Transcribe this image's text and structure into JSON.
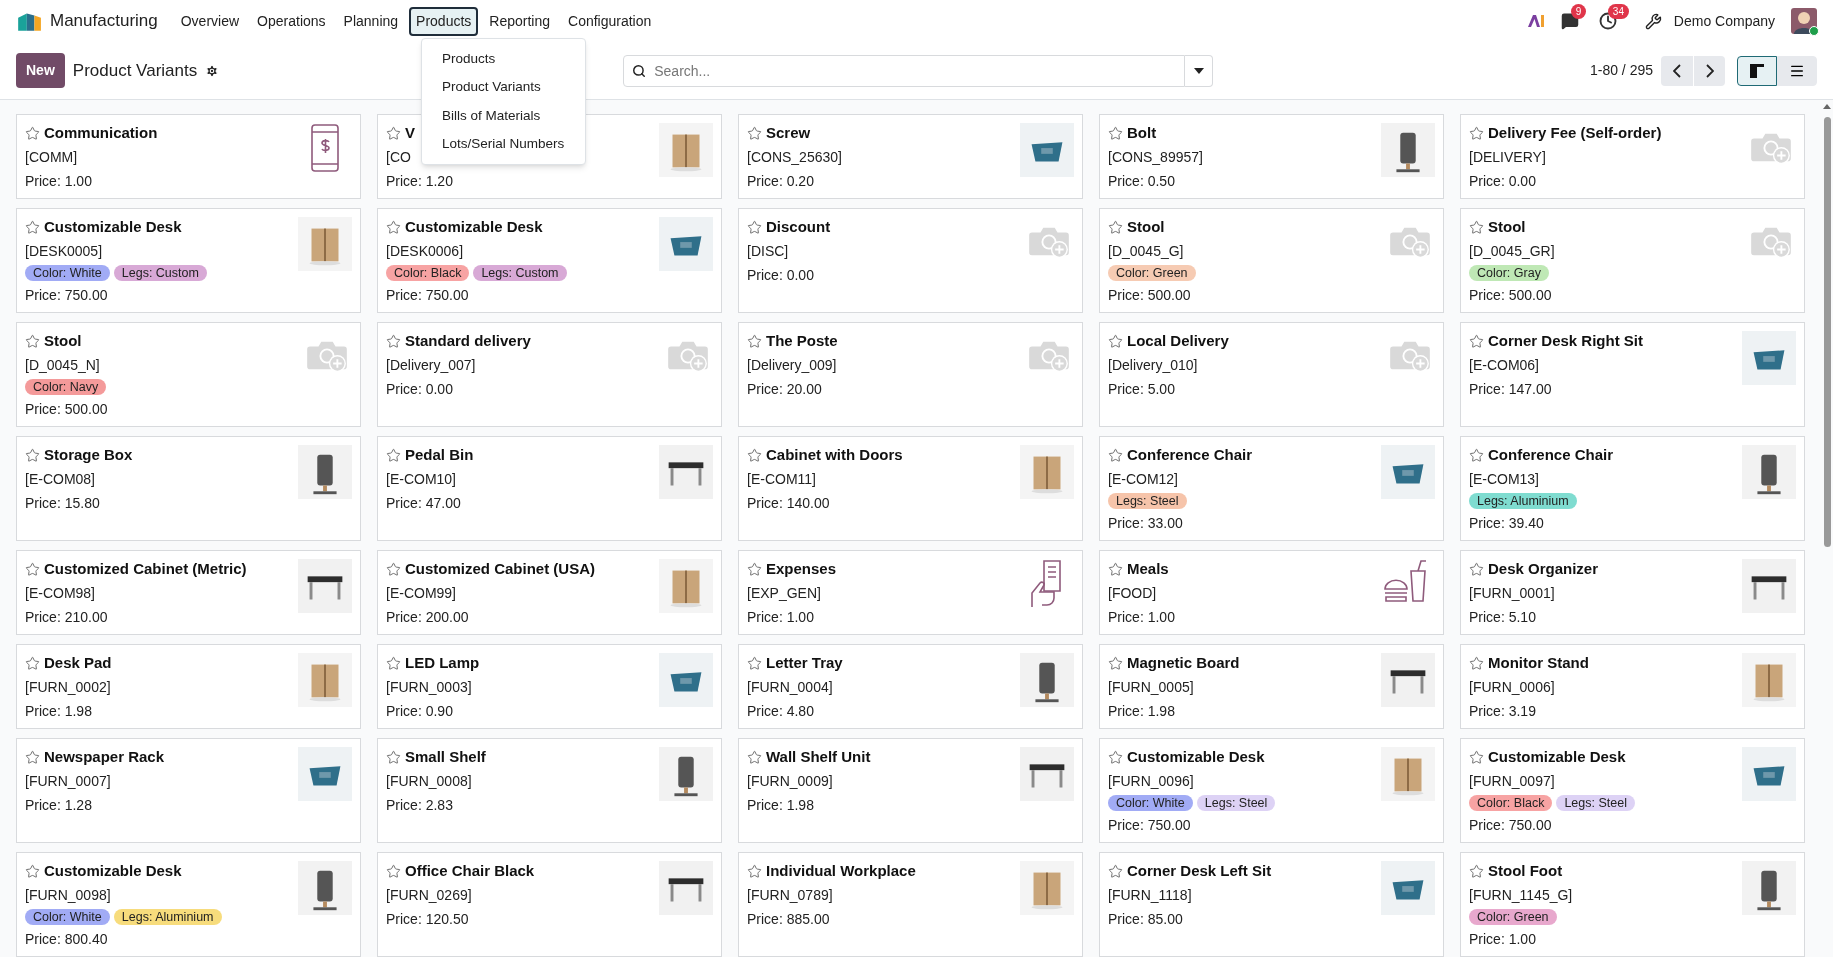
{
  "app": {
    "name": "Manufacturing"
  },
  "nav": [
    {
      "label": "Overview",
      "selected": false
    },
    {
      "label": "Operations",
      "selected": false
    },
    {
      "label": "Planning",
      "selected": false
    },
    {
      "label": "Products",
      "selected": true
    },
    {
      "label": "Reporting",
      "selected": false
    },
    {
      "label": "Configuration",
      "selected": false
    }
  ],
  "dropdown": {
    "items": [
      "Products",
      "Product Variants",
      "Bills of Materials",
      "Lots/Serial Numbers"
    ]
  },
  "systray": {
    "messages_badge": "9",
    "activities_badge": "34",
    "company": "Demo Company"
  },
  "control_panel": {
    "new_button": "New",
    "title": "Product Variants",
    "search": {
      "placeholder": "Search..."
    },
    "pager": "1-80 / 295",
    "views": [
      {
        "kind": "kanban",
        "selected": true
      },
      {
        "kind": "list",
        "selected": false
      }
    ]
  },
  "cards": [
    {
      "name": "Communication",
      "code": "[COMM]",
      "price": "Price: 1.00",
      "kind": "phone"
    },
    {
      "name": "V",
      "code": "[CO",
      "price": "Price: 1.20",
      "kind": "picture"
    },
    {
      "name": "Screw",
      "code": "[CONS_25630]",
      "price": "Price: 0.20",
      "kind": "picture"
    },
    {
      "name": "Bolt",
      "code": "[CONS_89957]",
      "price": "Price: 0.50",
      "kind": "picture"
    },
    {
      "name": "Delivery Fee (Self-order)",
      "code": "[DELIVERY]",
      "price": "Price: 0.00",
      "kind": "camera"
    },
    {
      "name": "Customizable Desk",
      "code": "[DESK0005]",
      "price": "Price: 750.00",
      "kind": "picture",
      "tags": [
        {
          "label": "Color: White",
          "color": "#a1abf5"
        },
        {
          "label": "Legs: Custom",
          "color": "#d8a9d6"
        }
      ]
    },
    {
      "name": "Customizable Desk",
      "code": "[DESK0006]",
      "price": "Price: 750.00",
      "kind": "picture",
      "tags": [
        {
          "label": "Color: Black",
          "color": "#f7a3a3"
        },
        {
          "label": "Legs: Custom",
          "color": "#d8a9d6"
        }
      ]
    },
    {
      "name": "Discount",
      "code": "[DISC]",
      "price": "Price: 0.00",
      "kind": "camera"
    },
    {
      "name": "Stool",
      "code": "[D_0045_G]",
      "price": "Price: 500.00",
      "kind": "camera",
      "tags": [
        {
          "label": "Color: Green",
          "color": "#f6cbb3"
        }
      ]
    },
    {
      "name": "Stool",
      "code": "[D_0045_GR]",
      "price": "Price: 500.00",
      "kind": "camera",
      "tags": [
        {
          "label": "Color: Gray",
          "color": "#bfe8b5"
        }
      ]
    },
    {
      "name": "Stool",
      "code": "[D_0045_N]",
      "price": "Price: 500.00",
      "kind": "camera",
      "tags": [
        {
          "label": "Color: Navy",
          "color": "#f49a9a"
        }
      ]
    },
    {
      "name": "Standard delivery",
      "code": "[Delivery_007]",
      "price": "Price: 0.00",
      "kind": "camera"
    },
    {
      "name": "The Poste",
      "code": "[Delivery_009]",
      "price": "Price: 20.00",
      "kind": "camera"
    },
    {
      "name": "Local Delivery",
      "code": "[Delivery_010]",
      "price": "Price: 5.00",
      "kind": "camera"
    },
    {
      "name": "Corner Desk Right Sit",
      "code": "[E-COM06]",
      "price": "Price: 147.00",
      "kind": "picture"
    },
    {
      "name": "Storage Box",
      "code": "[E-COM08]",
      "price": "Price: 15.80",
      "kind": "picture"
    },
    {
      "name": "Pedal Bin",
      "code": "[E-COM10]",
      "price": "Price: 47.00",
      "kind": "picture"
    },
    {
      "name": "Cabinet with Doors",
      "code": "[E-COM11]",
      "price": "Price: 140.00",
      "kind": "picture"
    },
    {
      "name": "Conference Chair",
      "code": "[E-COM12]",
      "price": "Price: 33.00",
      "kind": "picture",
      "tags": [
        {
          "label": "Legs: Steel",
          "color": "#f6c4aa"
        }
      ]
    },
    {
      "name": "Conference Chair",
      "code": "[E-COM13]",
      "price": "Price: 39.40",
      "kind": "picture",
      "tags": [
        {
          "label": "Legs: Aluminium",
          "color": "#7fdcd0"
        }
      ]
    },
    {
      "name": "Customized Cabinet (Metric)",
      "code": "[E-COM98]",
      "price": "Price: 210.00",
      "kind": "picture"
    },
    {
      "name": "Customized Cabinet (USA)",
      "code": "[E-COM99]",
      "price": "Price: 200.00",
      "kind": "picture"
    },
    {
      "name": "Expenses",
      "code": "[EXP_GEN]",
      "price": "Price: 1.00",
      "kind": "receipt"
    },
    {
      "name": "Meals",
      "code": "[FOOD]",
      "price": "Price: 1.00",
      "kind": "meal"
    },
    {
      "name": "Desk Organizer",
      "code": "[FURN_0001]",
      "price": "Price: 5.10",
      "kind": "picture"
    },
    {
      "name": "Desk Pad",
      "code": "[FURN_0002]",
      "price": "Price: 1.98",
      "kind": "picture"
    },
    {
      "name": "LED Lamp",
      "code": "[FURN_0003]",
      "price": "Price: 0.90",
      "kind": "picture"
    },
    {
      "name": "Letter Tray",
      "code": "[FURN_0004]",
      "price": "Price: 4.80",
      "kind": "picture"
    },
    {
      "name": "Magnetic Board",
      "code": "[FURN_0005]",
      "price": "Price: 1.98",
      "kind": "picture"
    },
    {
      "name": "Monitor Stand",
      "code": "[FURN_0006]",
      "price": "Price: 3.19",
      "kind": "picture"
    },
    {
      "name": "Newspaper Rack",
      "code": "[FURN_0007]",
      "price": "Price: 1.28",
      "kind": "picture"
    },
    {
      "name": "Small Shelf",
      "code": "[FURN_0008]",
      "price": "Price: 2.83",
      "kind": "picture"
    },
    {
      "name": "Wall Shelf Unit",
      "code": "[FURN_0009]",
      "price": "Price: 1.98",
      "kind": "picture"
    },
    {
      "name": "Customizable Desk",
      "code": "[FURN_0096]",
      "price": "Price: 750.00",
      "kind": "picture",
      "tags": [
        {
          "label": "Color: White",
          "color": "#a1abf5"
        },
        {
          "label": "Legs: Steel",
          "color": "#ddd2f5"
        }
      ]
    },
    {
      "name": "Customizable Desk",
      "code": "[FURN_0097]",
      "price": "Price: 750.00",
      "kind": "picture",
      "tags": [
        {
          "label": "Color: Black",
          "color": "#f7a3a3"
        },
        {
          "label": "Legs: Steel",
          "color": "#ddd2f5"
        }
      ]
    },
    {
      "name": "Customizable Desk",
      "code": "[FURN_0098]",
      "price": "Price: 800.40",
      "kind": "picture",
      "tags": [
        {
          "label": "Color: White",
          "color": "#a1abf5"
        },
        {
          "label": "Legs: Aluminium",
          "color": "#f7dc7c"
        }
      ]
    },
    {
      "name": "Office Chair Black",
      "code": "[FURN_0269]",
      "price": "Price: 120.50",
      "kind": "picture"
    },
    {
      "name": "Individual Workplace",
      "code": "[FURN_0789]",
      "price": "Price: 885.00",
      "kind": "picture"
    },
    {
      "name": "Corner Desk Left Sit",
      "code": "[FURN_1118]",
      "price": "Price: 85.00",
      "kind": "picture"
    },
    {
      "name": "Stool Foot",
      "code": "[FURN_1145_G]",
      "price": "Price: 1.00",
      "kind": "picture",
      "tags": [
        {
          "label": "Color: Green",
          "color": "#e8a8cd"
        }
      ]
    }
  ]
}
